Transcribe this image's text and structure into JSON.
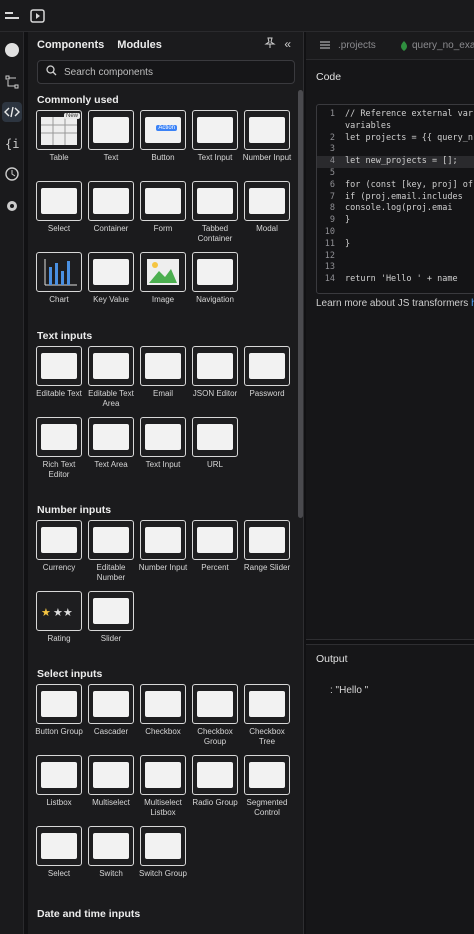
{
  "panel": {
    "tab_components": "Components",
    "tab_modules": "Modules",
    "search_placeholder": "Search components"
  },
  "sections": [
    {
      "title": "Commonly used",
      "items": [
        {
          "label": "Table",
          "badge": "New"
        },
        {
          "label": "Text"
        },
        {
          "label": "Button",
          "badge": "Action"
        },
        {
          "label": "Text Input"
        },
        {
          "label": "Number Input"
        },
        {
          "label": "Select"
        },
        {
          "label": "Container"
        },
        {
          "label": "Form"
        },
        {
          "label": "Tabbed Container"
        },
        {
          "label": "Modal"
        },
        {
          "label": "Chart"
        },
        {
          "label": "Key Value"
        },
        {
          "label": "Image"
        },
        {
          "label": "Navigation"
        }
      ]
    },
    {
      "title": "Text inputs",
      "items": [
        {
          "label": "Editable Text"
        },
        {
          "label": "Editable Text Area"
        },
        {
          "label": "Email"
        },
        {
          "label": "JSON Editor"
        },
        {
          "label": "Password"
        },
        {
          "label": "Rich Text Editor"
        },
        {
          "label": "Text Area"
        },
        {
          "label": "Text Input"
        },
        {
          "label": "URL"
        }
      ]
    },
    {
      "title": "Number inputs",
      "items": [
        {
          "label": "Currency"
        },
        {
          "label": "Editable Number"
        },
        {
          "label": "Number Input"
        },
        {
          "label": "Percent"
        },
        {
          "label": "Range Slider"
        },
        {
          "label": "Rating"
        },
        {
          "label": "Slider"
        }
      ]
    },
    {
      "title": "Select inputs",
      "items": [
        {
          "label": "Button Group"
        },
        {
          "label": "Cascader"
        },
        {
          "label": "Checkbox"
        },
        {
          "label": "Checkbox Group"
        },
        {
          "label": "Checkbox Tree"
        },
        {
          "label": "Listbox"
        },
        {
          "label": "Multiselect"
        },
        {
          "label": "Multiselect Listbox"
        },
        {
          "label": "Radio Group"
        },
        {
          "label": "Segmented Control"
        },
        {
          "label": "Select"
        },
        {
          "label": "Switch"
        },
        {
          "label": "Switch Group"
        }
      ]
    },
    {
      "title": "Date and time inputs",
      "items": []
    }
  ],
  "editor": {
    "tab1": ".projects",
    "tab2": "query_no_exa",
    "code_title": "Code",
    "lines": [
      {
        "n": "1",
        "t": "// Reference external var"
      },
      {
        "n": "",
        "t": "variables"
      },
      {
        "n": "2",
        "t": "let projects = {{ query_n"
      },
      {
        "n": "3",
        "t": ""
      },
      {
        "n": "4",
        "t": "let new_projects = [];"
      },
      {
        "n": "5",
        "t": ""
      },
      {
        "n": "6",
        "t": "for (const [key, proj] of"
      },
      {
        "n": "7",
        "t": "  if (proj.email.includes"
      },
      {
        "n": "8",
        "t": "    console.log(proj.emai"
      },
      {
        "n": "9",
        "t": "  }"
      },
      {
        "n": "10",
        "t": ""
      },
      {
        "n": "11",
        "t": "}"
      },
      {
        "n": "12",
        "t": ""
      },
      {
        "n": "13",
        "t": ""
      },
      {
        "n": "14",
        "t": "return 'Hello ' + name"
      }
    ],
    "learn_text": "Learn more about JS transformers",
    "learn_link": "h",
    "output_title": "Output",
    "output_value": ":  \"Hello \""
  },
  "colors": {
    "accent": "#3b82f6",
    "link": "#58a6ff"
  }
}
